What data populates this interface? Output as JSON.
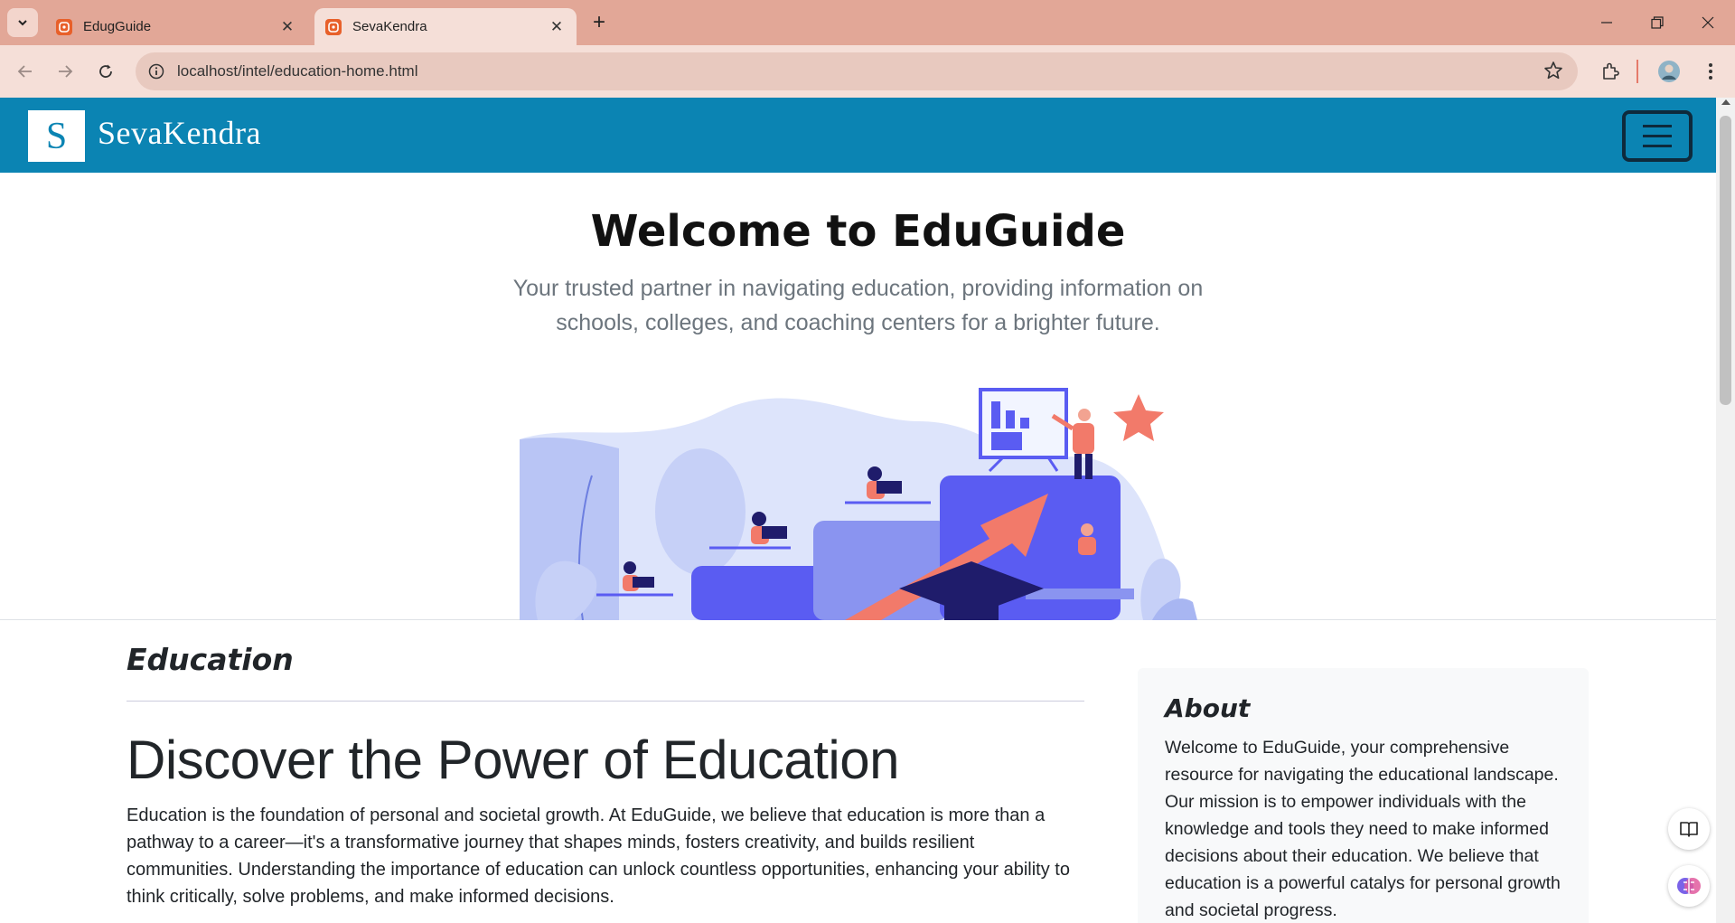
{
  "browser": {
    "tabs": [
      {
        "title": "EdugGuide",
        "active": false
      },
      {
        "title": "SevaKendra",
        "active": true
      }
    ],
    "url": "localhost/intel/education-home.html"
  },
  "site": {
    "brand_letter": "S",
    "brand_name": "SevaKendra",
    "brand_color": "#0b84b3"
  },
  "hero": {
    "title": "Welcome to EduGuide",
    "subtitle": "Your trusted partner in navigating education, providing information on schools, colleges, and coaching centers for a brighter future."
  },
  "main": {
    "section_title": "Education",
    "heading": "Discover the Power of Education",
    "body": "Education is the foundation of personal and societal growth. At EduGuide, we believe that education is more than a pathway to a career—it's a transformative journey that shapes minds, fosters creativity, and builds resilient communities. Understanding the importance of education can unlock countless opportunities, enhancing your ability to think critically, solve problems, and make informed decisions."
  },
  "sidebar": {
    "title": "About",
    "body": "Welcome to EduGuide, your comprehensive resource for navigating the educational landscape. Our mission is to empower individuals with the knowledge and tools they need to make informed decisions about their education. We believe that education is a powerful catalys for personal growth and societal progress."
  },
  "icons": [
    "tab-list-icon",
    "favicon-icon",
    "close-icon",
    "new-tab-icon",
    "minimize-icon",
    "restore-icon",
    "window-close-icon",
    "back-icon",
    "forward-icon",
    "reload-icon",
    "site-info-icon",
    "bookmark-star-icon",
    "extensions-icon",
    "profile-avatar",
    "more-menu-icon",
    "hamburger-icon",
    "reading-mode-icon",
    "ai-assistant-icon"
  ]
}
